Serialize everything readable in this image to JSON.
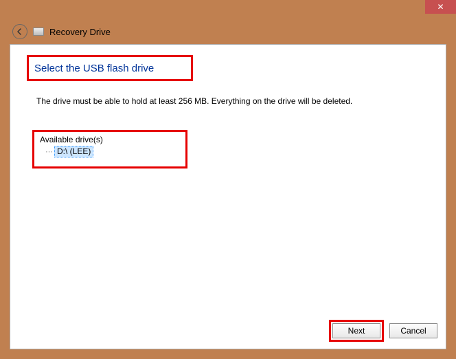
{
  "window": {
    "close_glyph": "✕"
  },
  "header": {
    "title": "Recovery Drive"
  },
  "main": {
    "heading": "Select the USB flash drive",
    "instruction": "The drive must be able to hold at least 256 MB. Everything on the drive will be deleted.",
    "drives_label": "Available drive(s)",
    "drives": [
      {
        "label": "D:\\ (LEE)",
        "selected": true
      }
    ]
  },
  "buttons": {
    "next": "Next",
    "cancel": "Cancel"
  },
  "annotations": {
    "highlight_color": "#e60000"
  }
}
